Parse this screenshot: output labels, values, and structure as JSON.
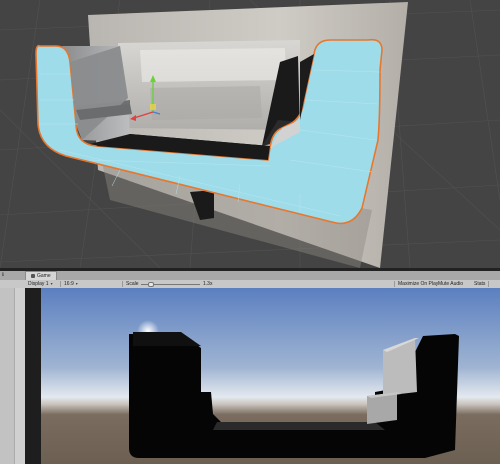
{
  "scene": {
    "corner_label_top": "<",
    "corner_label_bottom": "≡"
  },
  "game_tab": {
    "side_glyph": "ℹ",
    "label": "Game"
  },
  "toolbar": {
    "display": "Display 1",
    "aspect": "16:9",
    "scale_label": "Scale",
    "scale_value": "1.3x",
    "maximize": "Maximize On Play",
    "mute": "Mute Audio",
    "stats": "Stats"
  },
  "colors": {
    "selection_outline": "#e8772e",
    "selected_face": "#9fdcea",
    "sky_top": "#5b7fc0",
    "horizon": "#e4e9ef",
    "ground": "#6c6052",
    "gizmo_y": "#6bd13a",
    "gizmo_x": "#e04040",
    "gizmo_z": "#3f7fe0"
  },
  "icons": [
    "game-view-icon",
    "dropdown-chevron-icon",
    "transform-gizmo-icon"
  ]
}
